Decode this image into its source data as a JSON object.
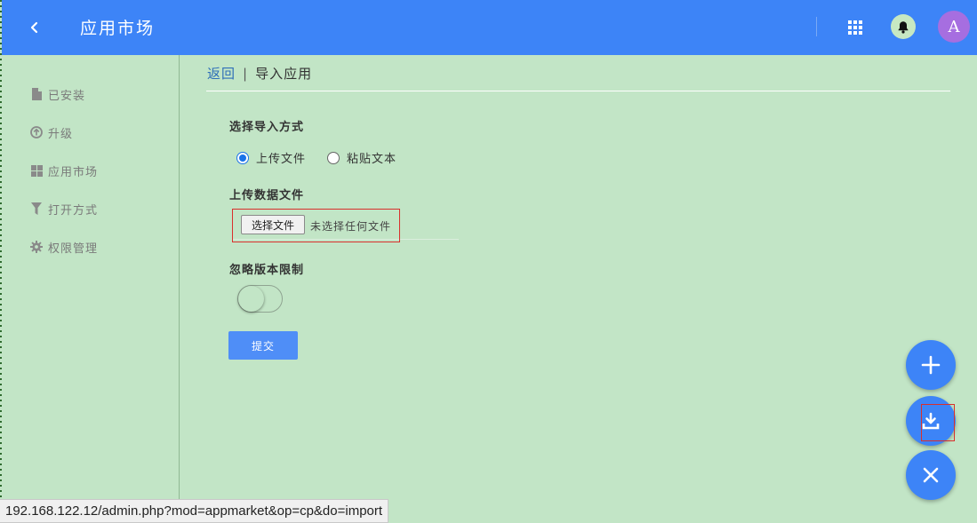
{
  "header": {
    "title": "应用市场",
    "avatar_letter": "A"
  },
  "sidebar": {
    "items": [
      {
        "label": "已安装",
        "icon": "file-icon"
      },
      {
        "label": "升级",
        "icon": "upgrade-circle-icon"
      },
      {
        "label": "应用市场",
        "icon": "grid-icon"
      },
      {
        "label": "打开方式",
        "icon": "filter-icon"
      },
      {
        "label": "权限管理",
        "icon": "gear-icon"
      }
    ]
  },
  "breadcrumb": {
    "back": "返回",
    "separator": "|",
    "current": "导入应用"
  },
  "form": {
    "import_method_label": "选择导入方式",
    "options": [
      "上传文件",
      "粘贴文本"
    ],
    "selected_option": "上传文件",
    "upload_label": "上传数据文件",
    "choose_file_button": "选择文件",
    "no_file_text": "未选择任何文件",
    "ignore_version_label": "忽略版本限制",
    "ignore_version_enabled": false,
    "submit_label": "提交"
  },
  "fabs": [
    "plus-icon",
    "download-icon",
    "close-icon"
  ],
  "status_url": "192.168.122.12/admin.php?mod=appmarket&op=cp&do=import",
  "colors": {
    "header": "#3d84f7",
    "background": "#c2e5c6",
    "accent": "#4f8ef7",
    "highlight": "#d9302c"
  }
}
